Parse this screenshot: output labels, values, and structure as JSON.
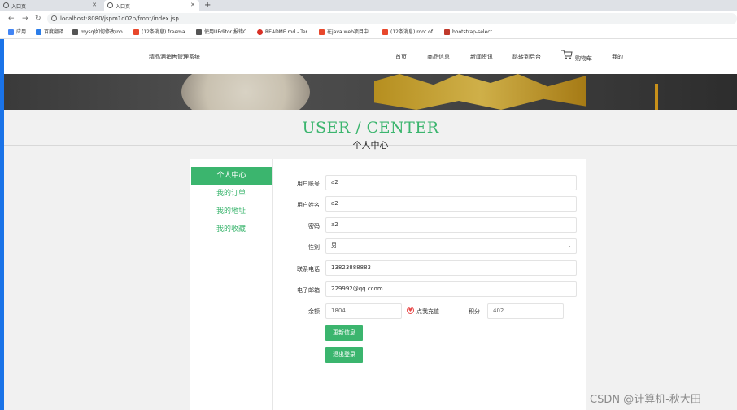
{
  "browser": {
    "tabs": [
      {
        "label": "入口页"
      },
      {
        "label": "入口页"
      }
    ],
    "new_tab": "+",
    "url": "localhost:8080/jspm1d02b/front/index.jsp",
    "bookmarks": [
      {
        "label": "应用",
        "color": "#4285f4"
      },
      {
        "label": "百度翻译",
        "color": "#2b7de9"
      },
      {
        "label": "mysql如何修改roo...",
        "color": "#555555"
      },
      {
        "label": "(12条消息) freema...",
        "color": "#e8472b"
      },
      {
        "label": "使用UEditor 报错C...",
        "color": "#555555"
      },
      {
        "label": "README.md - Ter...",
        "color": "#d93025"
      },
      {
        "label": "在java web项目中...",
        "color": "#e8472b"
      },
      {
        "label": "(12条消息) root of...",
        "color": "#e8472b"
      },
      {
        "label": "bootstrap-select...",
        "color": "#c0392b"
      }
    ]
  },
  "site": {
    "title": "精品酒销售管理系统",
    "nav": [
      "首页",
      "商品信息",
      "新闻资讯",
      "跳转到后台",
      "购物车",
      "我的"
    ]
  },
  "page": {
    "title_en": "USER / CENTER",
    "title_cn": "个人中心"
  },
  "sidebar": {
    "items": [
      {
        "label": "个人中心",
        "active": true
      },
      {
        "label": "我的订单",
        "active": false
      },
      {
        "label": "我的地址",
        "active": false
      },
      {
        "label": "我的收藏",
        "active": false
      }
    ]
  },
  "form": {
    "account": {
      "label": "用户账号",
      "value": "a2"
    },
    "name": {
      "label": "用户姓名",
      "value": "a2"
    },
    "password": {
      "label": "密码",
      "value": "a2"
    },
    "gender": {
      "label": "性别",
      "value": "男"
    },
    "phone": {
      "label": "联系电话",
      "value": "13823888883"
    },
    "email": {
      "label": "电子邮箱",
      "value": "229992@qq.ccom"
    },
    "balance": {
      "label": "余额",
      "value": "1804"
    },
    "recharge_label": "点我充值",
    "points": {
      "label": "积分",
      "value": "402"
    },
    "update_button": "更新信息",
    "logout_button": "退出登录"
  },
  "watermark": "CSDN @计算机-秋大田",
  "colors": {
    "accent": "#3bb56e"
  }
}
